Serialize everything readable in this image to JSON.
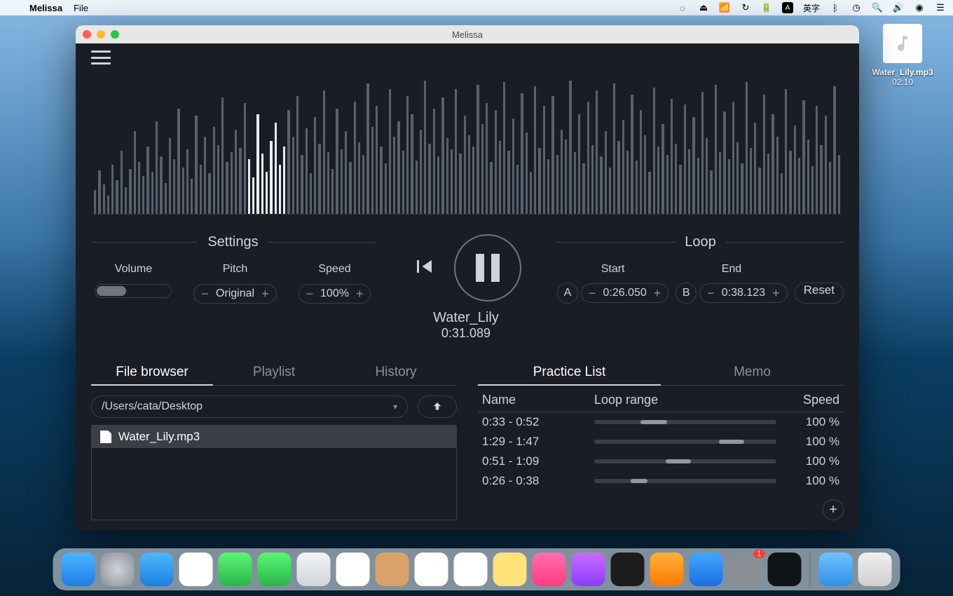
{
  "menubar": {
    "app_name": "Melissa",
    "items": [
      "File"
    ],
    "ime_label": "英字"
  },
  "desktop": {
    "file_name": "Water_Lily.mp3",
    "file_duration": "02:10"
  },
  "window": {
    "title": "Melissa"
  },
  "settings": {
    "section_title": "Settings",
    "volume_label": "Volume",
    "pitch_label": "Pitch",
    "pitch_value": "Original",
    "speed_label": "Speed",
    "speed_value": "100%"
  },
  "playback": {
    "track_name": "Water_Lily",
    "track_time": "0:31.089"
  },
  "loop": {
    "section_title": "Loop",
    "start_label": "Start",
    "end_label": "End",
    "a_label": "A",
    "b_label": "B",
    "start_value": "0:26.050",
    "end_value": "0:38.123",
    "reset_label": "Reset"
  },
  "tabs_left": {
    "file_browser": "File browser",
    "playlist": "Playlist",
    "history": "History"
  },
  "tabs_right": {
    "practice_list": "Practice List",
    "memo": "Memo"
  },
  "file_browser": {
    "path": "/Users/cata/Desktop",
    "files": [
      {
        "name": "Water_Lily.mp3"
      }
    ]
  },
  "practice": {
    "head_name": "Name",
    "head_range": "Loop range",
    "head_speed": "Speed",
    "total_seconds": 130,
    "rows": [
      {
        "name": "0:33 - 0:52",
        "start": 33,
        "end": 52,
        "speed": "100 %"
      },
      {
        "name": "1:29 - 1:47",
        "start": 89,
        "end": 107,
        "speed": "100 %"
      },
      {
        "name": "0:51 - 1:09",
        "start": 51,
        "end": 69,
        "speed": "100 %"
      },
      {
        "name": "0:26 - 0:38",
        "start": 26,
        "end": 38,
        "speed": "100 %"
      }
    ]
  },
  "dock": {
    "badge": "1",
    "apps": [
      {
        "name": "finder",
        "bg": "linear-gradient(#4cb4ff,#1f7fe6)"
      },
      {
        "name": "launchpad",
        "bg": "radial-gradient(circle,#d0d4d9,#8a8f96)"
      },
      {
        "name": "safari",
        "bg": "linear-gradient(#4fb7ff,#1b7fe0)"
      },
      {
        "name": "mail",
        "bg": "#ffffff"
      },
      {
        "name": "messages",
        "bg": "linear-gradient(#5bf675,#2bb54a)"
      },
      {
        "name": "facetime",
        "bg": "linear-gradient(#5bf675,#2bb54a)"
      },
      {
        "name": "maps",
        "bg": "linear-gradient(#f2f4f6,#cfd5db)"
      },
      {
        "name": "photos",
        "bg": "#ffffff"
      },
      {
        "name": "contacts",
        "bg": "#d9a26a"
      },
      {
        "name": "calendar",
        "bg": "#ffffff"
      },
      {
        "name": "reminders",
        "bg": "#ffffff"
      },
      {
        "name": "notes",
        "bg": "#ffe27a"
      },
      {
        "name": "music",
        "bg": "linear-gradient(#ff6fb0,#ff3d7f)"
      },
      {
        "name": "podcasts",
        "bg": "linear-gradient(#c86dff,#8b3dff)"
      },
      {
        "name": "tv",
        "bg": "#1c1c1c"
      },
      {
        "name": "books",
        "bg": "linear-gradient(#ffb13d,#ff7a00)"
      },
      {
        "name": "appstore",
        "bg": "linear-gradient(#3fa8ff,#1c6fe0)"
      },
      {
        "name": "preferences",
        "bg": "#8a8f96"
      },
      {
        "name": "melissa",
        "bg": "#111418"
      }
    ]
  },
  "waveform": {
    "bright_start": 35,
    "bright_end": 43,
    "heights": [
      34,
      62,
      42,
      26,
      70,
      48,
      90,
      38,
      64,
      118,
      74,
      54,
      96,
      60,
      132,
      82,
      44,
      108,
      78,
      150,
      66,
      92,
      50,
      140,
      70,
      110,
      58,
      124,
      98,
      166,
      74,
      88,
      120,
      94,
      158,
      78,
      52,
      142,
      86,
      60,
      104,
      130,
      70,
      96,
      148,
      110,
      168,
      84,
      122,
      58,
      138,
      100,
      176,
      88,
      64,
      150,
      92,
      118,
      74,
      160,
      102,
      84,
      186,
      124,
      154,
      96,
      72,
      178,
      110,
      132,
      90,
      168,
      142,
      76,
      120,
      190,
      100,
      150,
      82,
      166,
      108,
      92,
      178,
      86,
      140,
      112,
      96,
      184,
      128,
      158,
      74,
      148,
      104,
      188,
      90,
      136,
      70,
      172,
      116,
      60,
      182,
      94,
      154,
      78,
      168,
      84,
      120,
      106,
      190,
      88,
      142,
      72,
      160,
      98,
      176,
      82,
      118,
      66,
      186,
      104,
      134,
      90,
      170,
      76,
      148,
      112,
      60,
      180,
      96,
      128,
      84,
      164,
      100,
      70,
      156,
      92,
      138,
      80,
      174,
      108,
      62,
      184,
      88,
      146,
      78,
      160,
      102,
      72,
      188,
      94,
      130,
      66,
      170,
      86,
      142,
      110,
      58,
      178,
      90,
      126,
      80,
      162,
      106,
      68,
      154,
      98,
      140,
      74,
      182,
      84
    ]
  }
}
